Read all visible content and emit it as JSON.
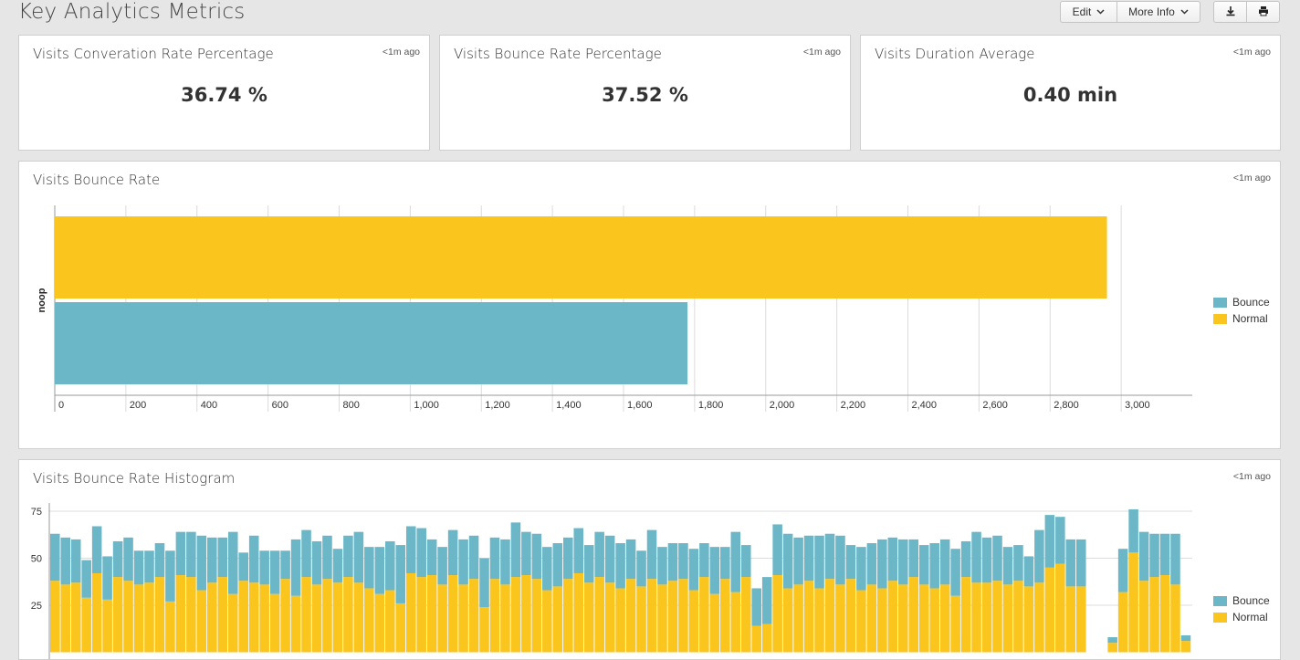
{
  "header": {
    "title": "Key Analytics Metrics",
    "edit_label": "Edit",
    "more_info_label": "More Info",
    "download_icon": "download-icon",
    "print_icon": "print-icon"
  },
  "colors": {
    "bounce": "#6bb7c8",
    "normal": "#fac51c"
  },
  "single_values": [
    {
      "title": "Visits Converation Rate Percentage",
      "time": "<1m ago",
      "value": "36.74 %"
    },
    {
      "title": "Visits Bounce Rate Percentage",
      "time": "<1m ago",
      "value": "37.52 %"
    },
    {
      "title": "Visits Duration Average",
      "time": "<1m ago",
      "value": "0.40 min"
    }
  ],
  "bar_panel": {
    "title": "Visits Bounce Rate",
    "time": "<1m ago"
  },
  "hist_panel": {
    "title": "Visits Bounce Rate Histogram",
    "time": "<1m ago"
  },
  "chart_data": [
    {
      "type": "bar",
      "orientation": "horizontal",
      "categories": [
        "noop"
      ],
      "series": [
        {
          "name": "Normal",
          "values": [
            2960
          ]
        },
        {
          "name": "Bounce",
          "values": [
            1780
          ]
        }
      ],
      "xlim": [
        0,
        3200
      ],
      "xticks": [
        0,
        200,
        400,
        600,
        800,
        1000,
        1200,
        1400,
        1600,
        1800,
        2000,
        2200,
        2400,
        2600,
        2800,
        3000
      ],
      "xtick_labels": [
        "0",
        "200",
        "400",
        "600",
        "800",
        "1,000",
        "1,200",
        "1,400",
        "1,600",
        "1,800",
        "2,000",
        "2,200",
        "2,400",
        "2,600",
        "2,800",
        "3,000"
      ],
      "ylabel": "noop",
      "grid": true,
      "legend": [
        "Bounce",
        "Normal"
      ],
      "legend_placement": "right"
    },
    {
      "type": "bar",
      "stacked": true,
      "ylim": [
        0,
        80
      ],
      "yticks": [
        25,
        50,
        75
      ],
      "grid": true,
      "legend": [
        "Bounce",
        "Normal"
      ],
      "legend_placement": "right",
      "series": [
        {
          "name": "Normal",
          "values": [
            38,
            36,
            37,
            29,
            42,
            28,
            40,
            38,
            36,
            37,
            40,
            27,
            41,
            40,
            33,
            37,
            40,
            31,
            38,
            37,
            36,
            31,
            39,
            30,
            40,
            36,
            39,
            37,
            40,
            37,
            34,
            31,
            33,
            26,
            42,
            40,
            41,
            36,
            41,
            36,
            39,
            24,
            39,
            36,
            40,
            41,
            39,
            33,
            35,
            39,
            42,
            37,
            40,
            37,
            34,
            39,
            35,
            39,
            36,
            38,
            39,
            33,
            40,
            31,
            39,
            32,
            40,
            14,
            15,
            41,
            34,
            36,
            38,
            34,
            39,
            36,
            39,
            33,
            36,
            34,
            38,
            36,
            40,
            36,
            34,
            36,
            30,
            40,
            37,
            37,
            38,
            36,
            38,
            35,
            37,
            45,
            47,
            35,
            35,
            null,
            null,
            5,
            32,
            53,
            38,
            40,
            41,
            36,
            6
          ]
        },
        {
          "name": "Bounce",
          "values": [
            25,
            25,
            23,
            20,
            25,
            23,
            19,
            23,
            18,
            17,
            18,
            27,
            23,
            24,
            29,
            24,
            21,
            33,
            15,
            25,
            18,
            23,
            15,
            30,
            25,
            23,
            23,
            18,
            22,
            27,
            22,
            25,
            26,
            31,
            25,
            26,
            19,
            20,
            24,
            24,
            23,
            26,
            22,
            24,
            29,
            23,
            24,
            23,
            23,
            22,
            24,
            20,
            24,
            25,
            24,
            21,
            19,
            26,
            20,
            20,
            19,
            22,
            18,
            25,
            17,
            32,
            17,
            20,
            25,
            27,
            29,
            25,
            24,
            28,
            24,
            26,
            18,
            23,
            22,
            26,
            23,
            24,
            20,
            21,
            24,
            24,
            25,
            19,
            27,
            24,
            24,
            20,
            19,
            16,
            28,
            28,
            25,
            25,
            25,
            null,
            null,
            3,
            23,
            23,
            26,
            23,
            22,
            27,
            3
          ]
        }
      ]
    }
  ]
}
